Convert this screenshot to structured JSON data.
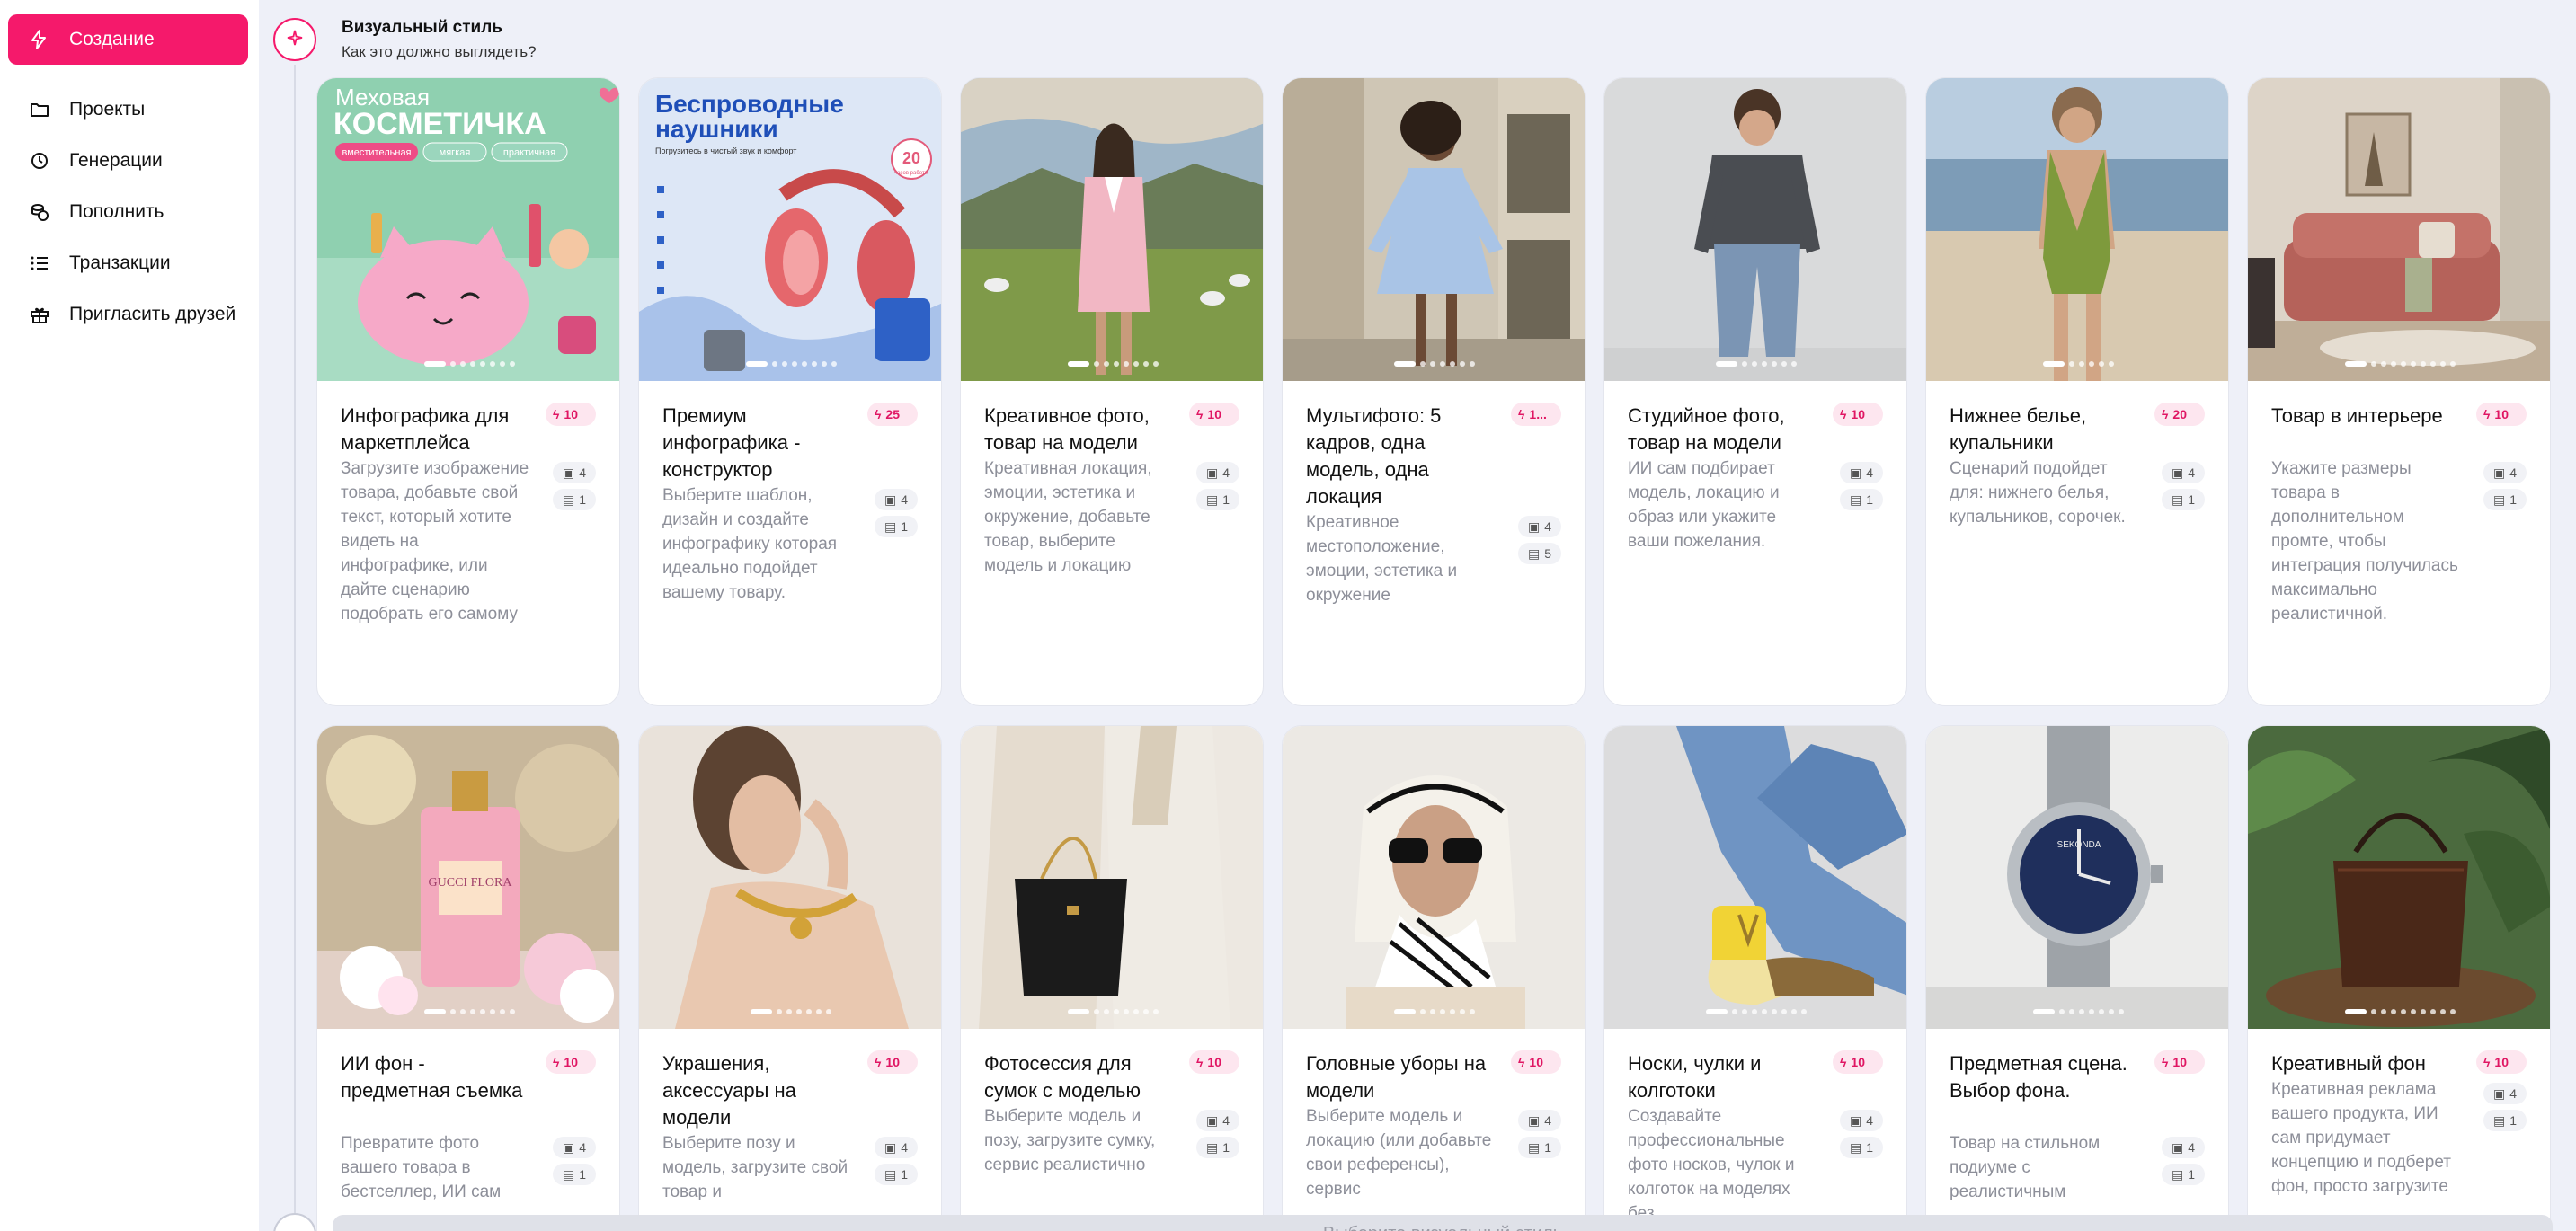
{
  "sidebar": {
    "items": [
      {
        "label": "Создание",
        "icon": "lightning-icon",
        "active": true
      },
      {
        "label": "Проекты",
        "icon": "folder-icon"
      },
      {
        "label": "Генерации",
        "icon": "history-icon"
      },
      {
        "label": "Пополнить",
        "icon": "coins-icon"
      },
      {
        "label": "Транзакции",
        "icon": "list-icon"
      },
      {
        "label": "Пригласить друзей",
        "icon": "gift-icon"
      }
    ]
  },
  "step": {
    "title": "Визуальный стиль",
    "subtitle": "Как это должно выглядеть?"
  },
  "cards": [
    {
      "title": "Инфографика для маркетплейса",
      "price": "10",
      "desc": "Загрузите изображение товара, добавьте свой текст, который хотите видеть на инфографике, или дайте сценарию подобрать его самому",
      "images": "4",
      "outputs": "1",
      "overlay": {
        "line1": "Меховая",
        "line2": "КОСМЕТИЧКА",
        "chips": [
          "вместительная",
          "мягкая",
          "практичная"
        ]
      }
    },
    {
      "title": "Премиум инфографика - конструктор",
      "price": "25",
      "desc": "Выберите шаблон, дизайн и создайте инфографику которая идеально подойдет вашему товару.",
      "images": "4",
      "outputs": "1",
      "overlay": {
        "line1": "Беспроводные",
        "line2": "наушники",
        "sub": "Погрузитесь в чистый звук и комфорт",
        "badge_num": "20",
        "badge_sub": "часов работы"
      }
    },
    {
      "title": "Креативное фото, товар на модели",
      "price": "10",
      "desc": "Креативная локация, эмоции, эстетика и окружение, добавьте товар, выберите модель и локацию",
      "images": "4",
      "outputs": "1"
    },
    {
      "title": "Мультифото: 5 кадров, одна модель, одна локация",
      "price": "1...",
      "desc": "Креативное местоположение, эмоции, эстетика и окружение",
      "images": "4",
      "outputs": "5"
    },
    {
      "title": "Студийное фото, товар на модели",
      "price": "10",
      "desc": "ИИ сам подбирает модель, локацию и образ или укажите ваши пожелания.",
      "images": "4",
      "outputs": "1"
    },
    {
      "title": "Нижнее белье, купальники",
      "price": "20",
      "desc": "Сценарий подойдет для: нижнего белья, купальников, сорочек.",
      "images": "4",
      "outputs": "1"
    },
    {
      "title": "Товар в интерьере",
      "price": "10",
      "desc": "Укажите размеры товара в дополнительном промте, чтобы интеграция получилась максимально реалистичной.",
      "images": "4",
      "outputs": "1"
    },
    {
      "title": "ИИ фон - предметная съемка",
      "price": "10",
      "desc": "Превратите фото вашего товара в бестселлер, ИИ сам",
      "images": "4",
      "outputs": "1",
      "overlay": {
        "label": "GUCCI FLORA"
      }
    },
    {
      "title": "Украшения, аксессуары на модели",
      "price": "10",
      "desc": "Выберите позу и модель, загрузите свой товар и",
      "images": "4",
      "outputs": "1"
    },
    {
      "title": "Фотосессия для сумок с моделью",
      "price": "10",
      "desc": "Выберите модель и позу, загрузите сумку, сервис реалистично",
      "images": "4",
      "outputs": "1"
    },
    {
      "title": "Головные уборы на модели",
      "price": "10",
      "desc": "Выберите модель и локацию (или добавьте свои референсы), сервис",
      "images": "4",
      "outputs": "1"
    },
    {
      "title": "Носки, чулки и колготоки",
      "price": "10",
      "desc": "Создавайте профессиональные фото носков, чулок и колготок на моделях без",
      "images": "4",
      "outputs": "1"
    },
    {
      "title": "Предметная сцена. Выбор фона.",
      "price": "10",
      "desc": "Товар на стильном подиуме с реалистичным",
      "images": "4",
      "outputs": "1",
      "overlay": {
        "label": "SEKONDA"
      }
    },
    {
      "title": "Креативный фон",
      "price": "10",
      "desc": "Креативная реклама вашего продукта, ИИ сам придумает концепцию и подберет фон, просто загрузите",
      "images": "4",
      "outputs": "1"
    }
  ],
  "bottom_input": {
    "placeholder": "Выберите визуальный стиль"
  },
  "colors": {
    "accent": "#f5196b",
    "accent_soft": "#fde6ef",
    "background": "#eef0f8"
  }
}
